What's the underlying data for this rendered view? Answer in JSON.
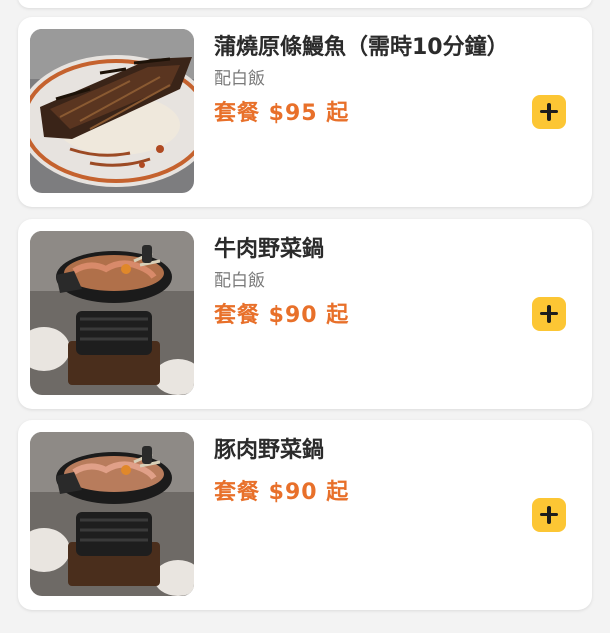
{
  "menu": {
    "items": [
      {
        "name": "蒲燒原條鰻魚（需時10分鐘）",
        "note": "配白飯",
        "price": "套餐 $95 起",
        "image_icon": "grilled-eel-rice-photo"
      },
      {
        "name": "牛肉野菜鍋",
        "note": "配白飯",
        "price": "套餐 $90 起",
        "image_icon": "beef-hotpot-photo"
      },
      {
        "name": "豚肉野菜鍋",
        "price": "套餐 $90 起",
        "image_icon": "pork-hotpot-photo"
      }
    ]
  },
  "colors": {
    "price": "#e8702a",
    "add_button": "#fcc634",
    "background": "#f3f3f3"
  },
  "icons": {
    "add": "plus-icon"
  }
}
